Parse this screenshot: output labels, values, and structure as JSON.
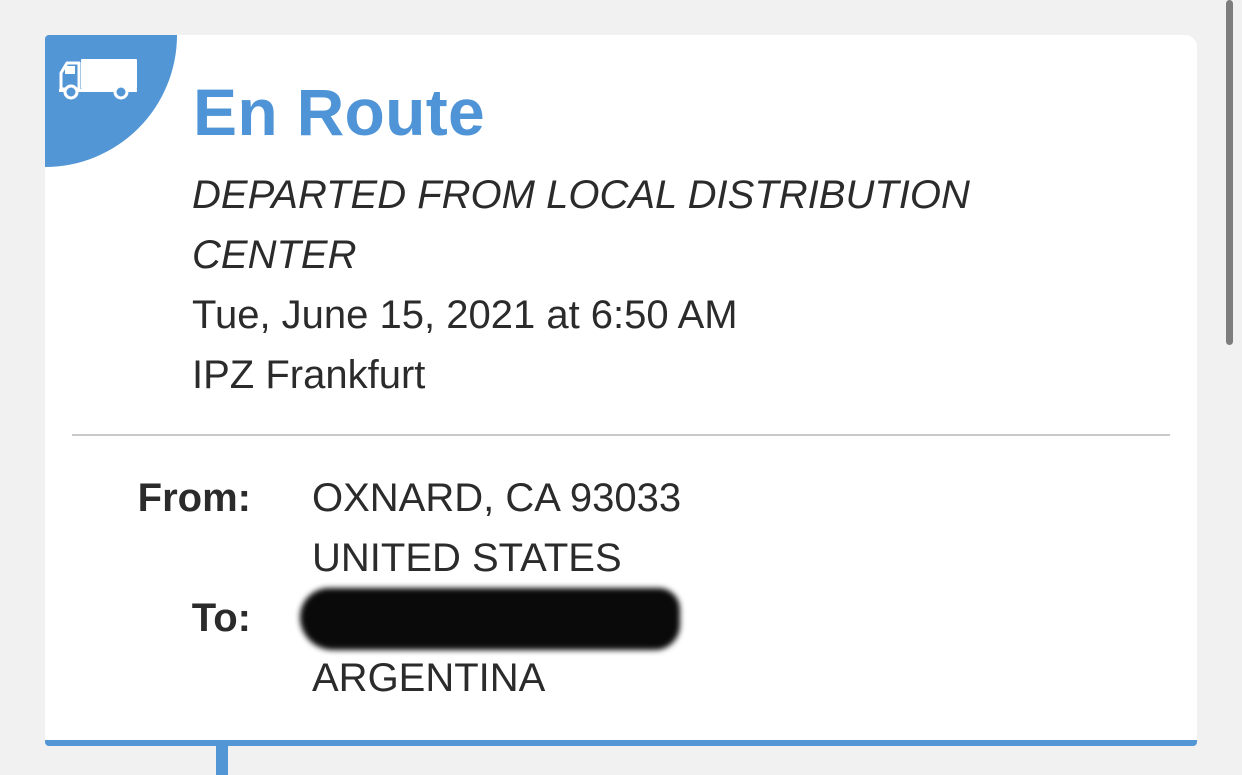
{
  "tracking": {
    "status_title": "En Route",
    "status_description_line1": "DEPARTED FROM LOCAL DISTRIBUTION",
    "status_description_line2": "CENTER",
    "date_time": "Tue, June 15, 2021 at 6:50 AM",
    "location": "IPZ Frankfurt",
    "status_icon": "truck-icon",
    "accent_color": "#5296d5"
  },
  "shipment": {
    "from_label": "From:",
    "from_line1": "OXNARD, CA 93033",
    "from_line2": "UNITED STATES",
    "to_label": "To:",
    "to_line2": "ARGENTINA"
  }
}
